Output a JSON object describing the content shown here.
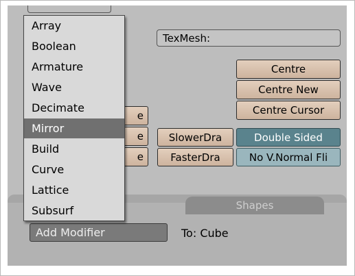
{
  "mesh": {
    "texmesh_label": "TexMesh:"
  },
  "centre_buttons": [
    "Centre",
    "Centre New",
    "Centre Cursor"
  ],
  "draw_buttons": {
    "slower": "SlowerDra",
    "faster": "FasterDra"
  },
  "toggles": {
    "double_sided": "Double Sided",
    "no_vnormal_flip": "No V.Normal Fli"
  },
  "partial_buttons": [
    "e",
    "e",
    "e"
  ],
  "tabs": {
    "shapes": "Shapes"
  },
  "modifiers": {
    "add_label": "Add Modifier",
    "to_label": "To: Cube"
  },
  "menu": {
    "items": [
      "Array",
      "Boolean",
      "Armature",
      "Wave",
      "Decimate",
      "Mirror",
      "Build",
      "Curve",
      "Lattice",
      "Subsurf"
    ],
    "active": "Mirror"
  },
  "colors": {
    "panel": "#bdbdbd",
    "tan_button": "#d7c1ae",
    "teal_toggle": "#5a838d",
    "menu_bg": "#d9d9d9",
    "menu_highlight": "#707070"
  }
}
